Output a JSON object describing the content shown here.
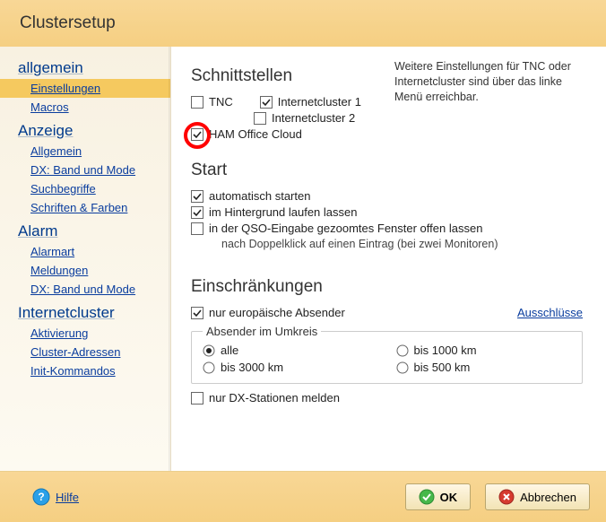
{
  "title": "Clustersetup",
  "sidebar": {
    "general": {
      "header": "allgemein",
      "items": [
        "Einstellungen",
        "Macros"
      ],
      "selected": 0
    },
    "anzeige": {
      "header": "Anzeige",
      "items": [
        "Allgemein",
        "DX: Band und Mode",
        "Suchbegriffe",
        "Schriften & Farben"
      ]
    },
    "alarm": {
      "header": "Alarm",
      "items": [
        "Alarmart",
        "Meldungen",
        "DX: Band und Mode"
      ]
    },
    "internet": {
      "header": "Internetcluster",
      "items": [
        "Aktivierung",
        "Cluster-Adressen",
        "Init-Kommandos"
      ]
    }
  },
  "sec_interfaces": {
    "title": "Schnittstellen",
    "tnc": {
      "label": "TNC",
      "checked": false
    },
    "ic1": {
      "label": "Internetcluster 1",
      "checked": true
    },
    "ic2": {
      "label": "Internetcluster 2",
      "checked": false
    },
    "cloud": {
      "label": "HAM Office Cloud",
      "checked": true
    },
    "hint": "Weitere Einstellungen für TNC oder Internetcluster sind über das linke Menü erreichbar."
  },
  "sec_start": {
    "title": "Start",
    "auto": {
      "label": "automatisch starten",
      "checked": true
    },
    "bg": {
      "label": "im Hintergrund laufen lassen",
      "checked": true
    },
    "zoom": {
      "label": "in der QSO-Eingabe gezoomtes Fenster offen lassen",
      "checked": false
    },
    "zoom_sub": "nach Doppelklick auf einen Eintrag (bei zwei Monitoren)"
  },
  "sec_restrict": {
    "title": "Einschränkungen",
    "euro": {
      "label": "nur europäische Absender",
      "checked": true
    },
    "excl_link": "Ausschlüsse",
    "grp_title": "Absender im Umkreis",
    "radios": {
      "all": {
        "label": "alle",
        "selected": true
      },
      "r1000": {
        "label": "bis 1000 km",
        "selected": false
      },
      "r3000": {
        "label": "bis 3000 km",
        "selected": false
      },
      "r500": {
        "label": "bis 500 km",
        "selected": false
      }
    },
    "dxonly": {
      "label": "nur DX-Stationen melden",
      "checked": false
    }
  },
  "footer": {
    "help": "Hilfe",
    "ok": "OK",
    "cancel": "Abbrechen"
  }
}
